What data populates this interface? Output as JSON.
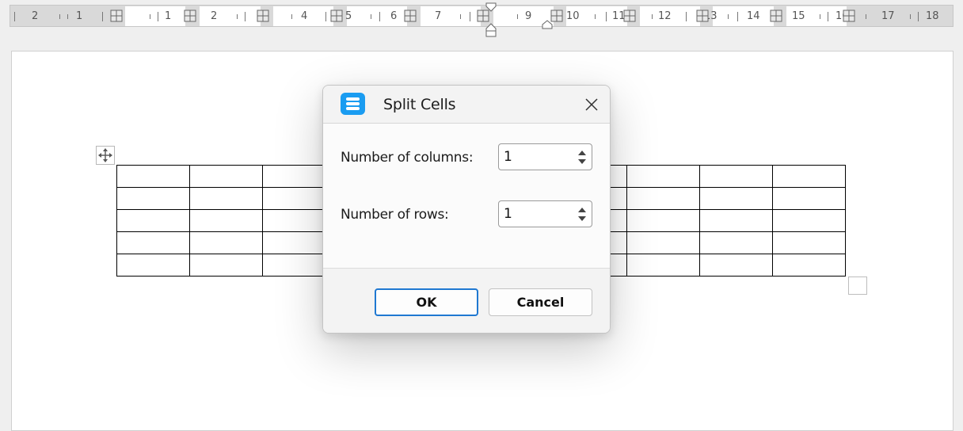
{
  "ruler": {
    "numbers": [
      "2",
      "1",
      "1",
      "2",
      "4",
      "5",
      "6",
      "7",
      "9",
      "10",
      "11",
      "12",
      "13",
      "14",
      "15",
      "16",
      "17",
      "18"
    ]
  },
  "dialog": {
    "title": "Split Cells",
    "app_icon": "list-icon",
    "close_icon": "close-icon",
    "fields": [
      {
        "label": "Number of columns:",
        "value": "1"
      },
      {
        "label": "Number of rows:",
        "value": "1"
      }
    ],
    "ok_label": "OK",
    "cancel_label": "Cancel"
  },
  "table": {
    "rows": 5,
    "columns": 10
  },
  "colors": {
    "accent": "#1a9cf1",
    "focus_border": "#1f78d1",
    "page": "#ffffff",
    "ruler": "#d9d9d9"
  }
}
